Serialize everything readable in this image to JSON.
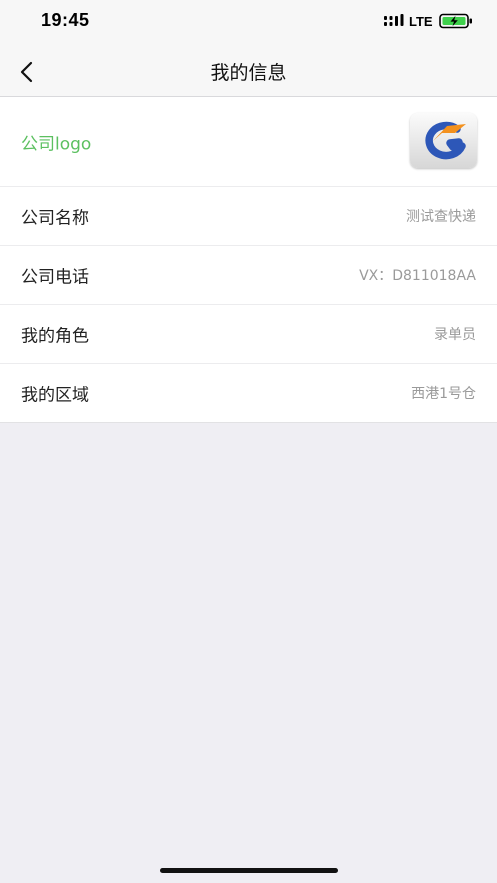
{
  "status_bar": {
    "time": "19:45",
    "network": "LTE",
    "battery_color": "#3fd14c"
  },
  "nav": {
    "title": "我的信息"
  },
  "rows": [
    {
      "label": "公司logo"
    },
    {
      "label": "公司名称",
      "value": "测试查快递"
    },
    {
      "label": "公司电话",
      "value": "VX：D811018AA"
    },
    {
      "label": "我的角色",
      "value": "录单员"
    },
    {
      "label": "我的区域",
      "value": "西港1号仓"
    }
  ],
  "icons": {
    "back": "chevron-left-icon",
    "signal": "signal-icon",
    "battery": "battery-charging-icon",
    "logo": "company-logo"
  },
  "colors": {
    "accent_green": "#5cc060",
    "logo_blue": "#2d57b8",
    "logo_orange": "#f3911e"
  }
}
